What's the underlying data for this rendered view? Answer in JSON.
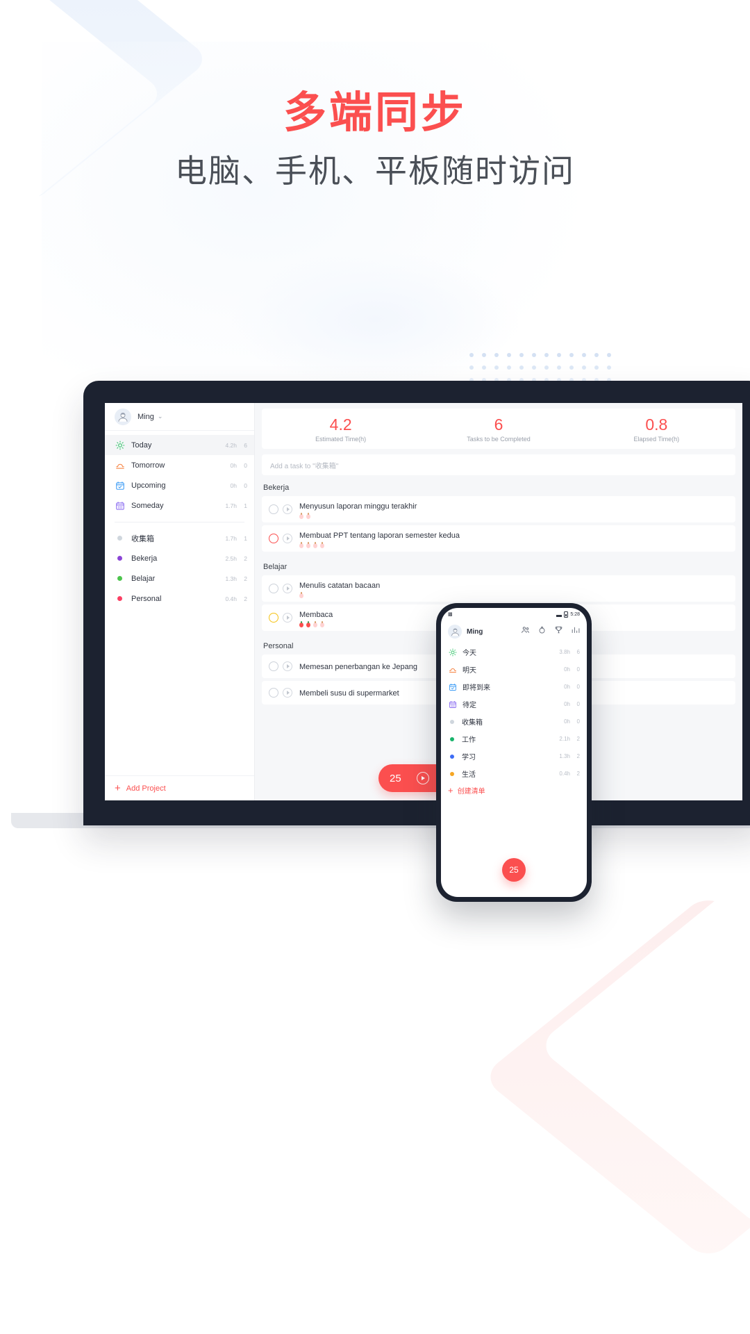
{
  "hero": {
    "title": "多端同步",
    "subtitle": "电脑、手机、平板随时访问",
    "title_color": "#fb4f4f",
    "subtitle_color": "#4a4f57"
  },
  "laptop": {
    "account": {
      "name": "Ming",
      "caret": "⌄",
      "avatar_icon": "user-avatar-icon"
    },
    "smart_lists": [
      {
        "icon": "sun-icon",
        "label": "Today",
        "hours": "4.2h",
        "count": "6",
        "color": "#33c46a",
        "active": true
      },
      {
        "icon": "sunrise-icon",
        "label": "Tomorrow",
        "hours": "0h",
        "count": "0",
        "color": "#f6813f",
        "active": false
      },
      {
        "icon": "calendar-check-icon",
        "label": "Upcoming",
        "hours": "0h",
        "count": "0",
        "color": "#3d9cf5",
        "active": false
      },
      {
        "icon": "calendar-icon",
        "label": "Someday",
        "hours": "1.7h",
        "count": "1",
        "color": "#8b6cf0",
        "active": false
      }
    ],
    "projects": [
      {
        "label": "收集箱",
        "hours": "1.7h",
        "count": "1",
        "color": "#cfd6dd"
      },
      {
        "label": "Bekerja",
        "hours": "2.5h",
        "count": "2",
        "color": "#8b44d6"
      },
      {
        "label": "Belajar",
        "hours": "1.3h",
        "count": "2",
        "color": "#4cc44c"
      },
      {
        "label": "Personal",
        "hours": "0.4h",
        "count": "2",
        "color": "#fb3f63"
      }
    ],
    "add_project_label": "Add Project",
    "stats": [
      {
        "value": "4.2",
        "label": "Estimated Time(h)"
      },
      {
        "value": "6",
        "label": "Tasks to be Completed"
      },
      {
        "value": "0.8",
        "label": "Elapsed Time(h)"
      }
    ],
    "add_task_placeholder": "Add a task to \"收集箱\"",
    "groups": [
      {
        "title": "Bekerja",
        "tasks": [
          {
            "title": "Menyusun laporan minggu terakhir",
            "circle": "gray",
            "pomos_done": 0,
            "pomos_total": 2
          },
          {
            "title": "Membuat PPT tentang laporan semester kedua",
            "circle": "red",
            "pomos_done": 0,
            "pomos_total": 4
          }
        ]
      },
      {
        "title": "Belajar",
        "tasks": [
          {
            "title": "Menulis catatan bacaan",
            "circle": "gray",
            "pomos_done": 0,
            "pomos_total": 1
          },
          {
            "title": "Membaca",
            "circle": "yellow",
            "pomos_done": 2,
            "pomos_total": 4
          }
        ]
      },
      {
        "title": "Personal",
        "tasks": [
          {
            "title": "Memesan penerbangan ke Jepang",
            "circle": "gray",
            "pomos_done": 0,
            "pomos_total": 0
          },
          {
            "title": "Membeli susu di supermarket",
            "circle": "gray",
            "pomos_done": 0,
            "pomos_total": 0
          }
        ]
      }
    ],
    "timer_pill": {
      "minutes": "25",
      "play_icon": "play-icon"
    }
  },
  "phone": {
    "status": {
      "left_icon": "qr-code-icon",
      "signal": "signal-icon",
      "battery_icon": "battery-icon",
      "time": "5:28"
    },
    "account": {
      "name": "Ming",
      "avatar_icon": "user-avatar-icon"
    },
    "header_actions": [
      "friends-icon",
      "pomodoro-icon",
      "achievement-icon",
      "statistics-icon"
    ],
    "smart_lists": [
      {
        "icon": "sun-icon",
        "label": "今天",
        "hours": "3.8h",
        "count": "6",
        "color": "#33c46a"
      },
      {
        "icon": "sunrise-icon",
        "label": "明天",
        "hours": "0h",
        "count": "0",
        "color": "#f6813f"
      },
      {
        "icon": "calendar-check-icon",
        "label": "即将到来",
        "hours": "0h",
        "count": "0",
        "color": "#3d9cf5"
      },
      {
        "icon": "calendar-icon",
        "label": "待定",
        "hours": "0h",
        "count": "0",
        "color": "#8b6cf0"
      }
    ],
    "projects": [
      {
        "label": "收集箱",
        "hours": "0h",
        "count": "0",
        "color": "#cfd6dd"
      },
      {
        "label": "工作",
        "hours": "2.1h",
        "count": "2",
        "color": "#18b36b"
      },
      {
        "label": "学习",
        "hours": "1.3h",
        "count": "2",
        "color": "#3d6cf5"
      },
      {
        "label": "生活",
        "hours": "0.4h",
        "count": "2",
        "color": "#f5a623"
      }
    ],
    "add_list_label": "创建清单",
    "fab": {
      "minutes": "25"
    }
  }
}
